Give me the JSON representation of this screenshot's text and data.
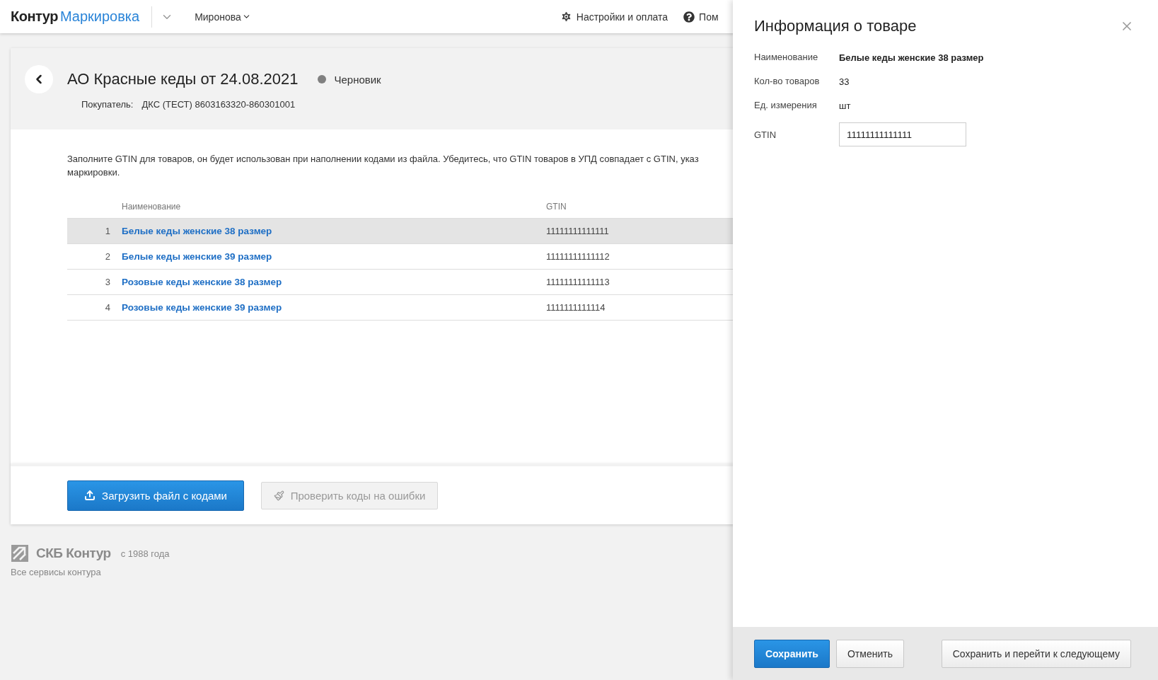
{
  "topbar": {
    "brand": "Контур",
    "product": "Маркировка",
    "user": "Миронова",
    "settings": "Настройки и оплата",
    "help": "Пом"
  },
  "document": {
    "title": "АО Красные кеды от 24.08.2021",
    "status": "Черновик",
    "buyer_label": "Покупатель:",
    "buyer": "ДКС (ТЕСТ) 8603163320-860301001"
  },
  "description_lines": [
    "Заполните GTIN для товаров, он будет использован при наполнении кодами из файла. Убедитесь, что GTIN товаров в УПД совпадает с GTIN, указ",
    "маркировки."
  ],
  "table": {
    "columns": [
      "Наименование",
      "GTIN"
    ],
    "rows": [
      {
        "number": "1",
        "name": "Белые кеды женские 38 размер",
        "gtin": "11111111111111",
        "selected": true
      },
      {
        "number": "2",
        "name": "Белые кеды женские 39 размер",
        "gtin": "11111111111112",
        "selected": false
      },
      {
        "number": "3",
        "name": "Розовые кеды женские 38 размер",
        "gtin": "11111111111113",
        "selected": false
      },
      {
        "number": "4",
        "name": "Розовые кеды женские 39 размер",
        "gtin": "1111111111114",
        "selected": false
      }
    ]
  },
  "actions": [
    {
      "label": "Загрузить файл с кодами",
      "disabled": false
    },
    {
      "label": "Проверить коды на ошибки",
      "disabled": true
    }
  ],
  "footer": {
    "company": "СКБ Контур",
    "since": "с 1988 года",
    "link": "Все сервисы контура"
  },
  "panel": {
    "title": "Информация о товаре",
    "fields": [
      {
        "label": "Наименование",
        "value": "Белые кеды женские 38 размер",
        "kind": "bold"
      },
      {
        "label": "Кол-во товаров",
        "value": "33",
        "kind": "text"
      },
      {
        "label": "Ед. измерения",
        "value": "шт",
        "kind": "text"
      },
      {
        "label": "GTIN",
        "value": "11111111111111",
        "kind": "input"
      }
    ],
    "buttons": [
      {
        "label": "Сохранить",
        "kind": "primary"
      },
      {
        "label": "Отменить",
        "kind": "default"
      },
      {
        "label": "Сохранить и перейти к следующему",
        "kind": "default"
      }
    ]
  }
}
